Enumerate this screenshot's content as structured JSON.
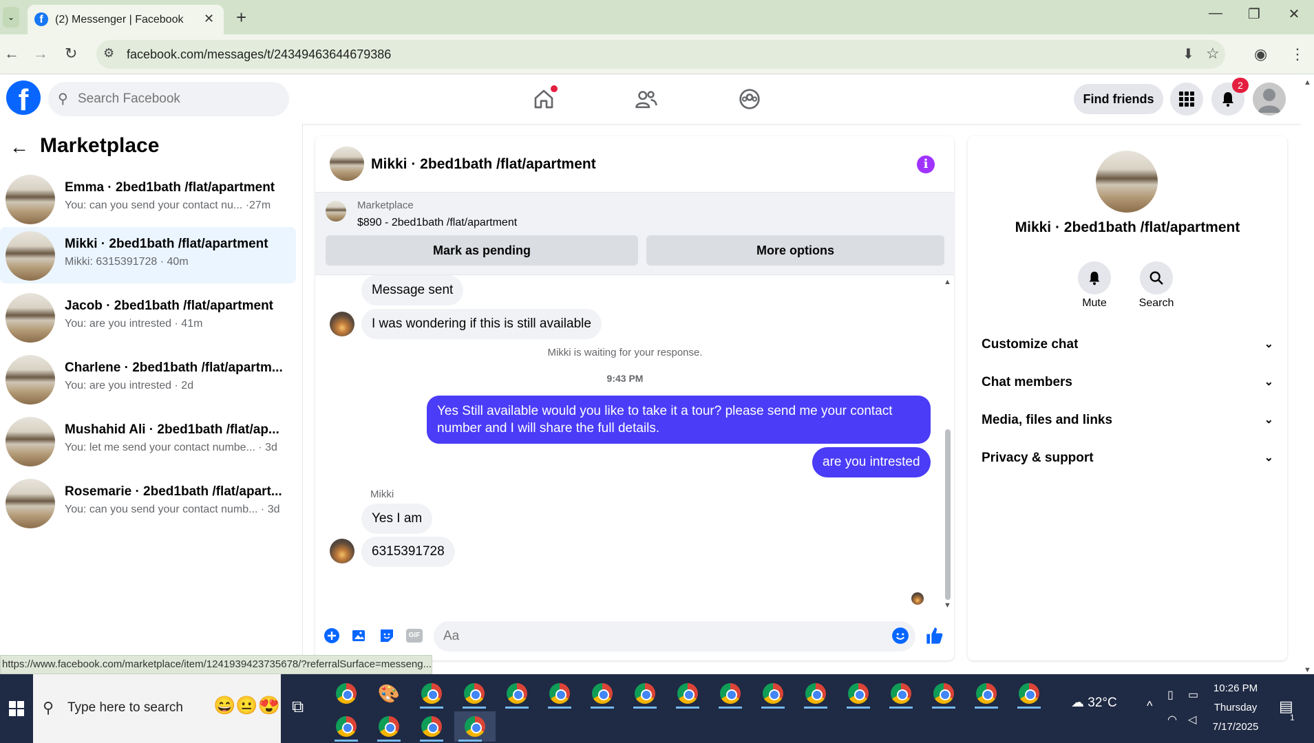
{
  "browser": {
    "tab_title": "(2) Messenger | Facebook",
    "url": "facebook.com/messages/t/24349463644679386",
    "status_url": "https://www.facebook.com/marketplace/item/1241939423735678/?referralSurface=messeng..."
  },
  "fb_header": {
    "search_placeholder": "Search Facebook",
    "find_friends": "Find friends",
    "notification_count": "2"
  },
  "left_pane": {
    "title": "Marketplace",
    "conversations": [
      {
        "name": "Emma · 2bed1bath /flat/apartment",
        "preview": "You: can you send your contact nu... ·27m",
        "active": false
      },
      {
        "name": "Mikki · 2bed1bath /flat/apartment",
        "preview": "Mikki: 6315391728 · 40m",
        "active": true
      },
      {
        "name": "Jacob · 2bed1bath /flat/apartment",
        "preview": "You: are you intrested · 41m",
        "active": false
      },
      {
        "name": "Charlene · 2bed1bath /flat/apartm...",
        "preview": "You: are you intrested · 2d",
        "active": false
      },
      {
        "name": "Mushahid Ali · 2bed1bath /flat/ap...",
        "preview": "You: let me send your contact numbe... · 3d",
        "active": false
      },
      {
        "name": "Rosemarie · 2bed1bath /flat/apart...",
        "preview": "You: can you send your contact numb... · 3d",
        "active": false
      }
    ]
  },
  "chat": {
    "title": "Mikki · 2bed1bath /flat/apartment",
    "listing_source": "Marketplace",
    "listing_price": "$890 - 2bed1bath /flat/apartment",
    "mark_pending": "Mark as pending",
    "more_options": "More options",
    "messages": {
      "m1": "Message sent",
      "m2": "I was wondering if this is still available",
      "waiting": "Mikki is waiting for your response.",
      "time": "9:43 PM",
      "out1_line1": "Yes Still available would you like to take it a tour? please send me your contact",
      "out1_line2": "number and I will share the full details.",
      "out2": "are you  intrested",
      "sender": "Mikki",
      "in3": "Yes I am",
      "in4": "6315391728"
    },
    "input_placeholder": "Aa"
  },
  "info_pane": {
    "name": "Mikki · 2bed1bath /flat/apartment",
    "mute": "Mute",
    "search": "Search",
    "sections": [
      "Customize chat",
      "Chat members",
      "Media, files and links",
      "Privacy & support"
    ]
  },
  "taskbar": {
    "search_text": "Type here to search",
    "weather": "32°C",
    "time": "10:26 PM",
    "day": "Thursday",
    "date": "7/17/2025",
    "notif": "1"
  },
  "colors": {
    "brand": "#0866ff",
    "outgoing_bubble": "#4a3cf7",
    "active_row": "#ebf5ff",
    "info_icon": "#a033ff"
  }
}
